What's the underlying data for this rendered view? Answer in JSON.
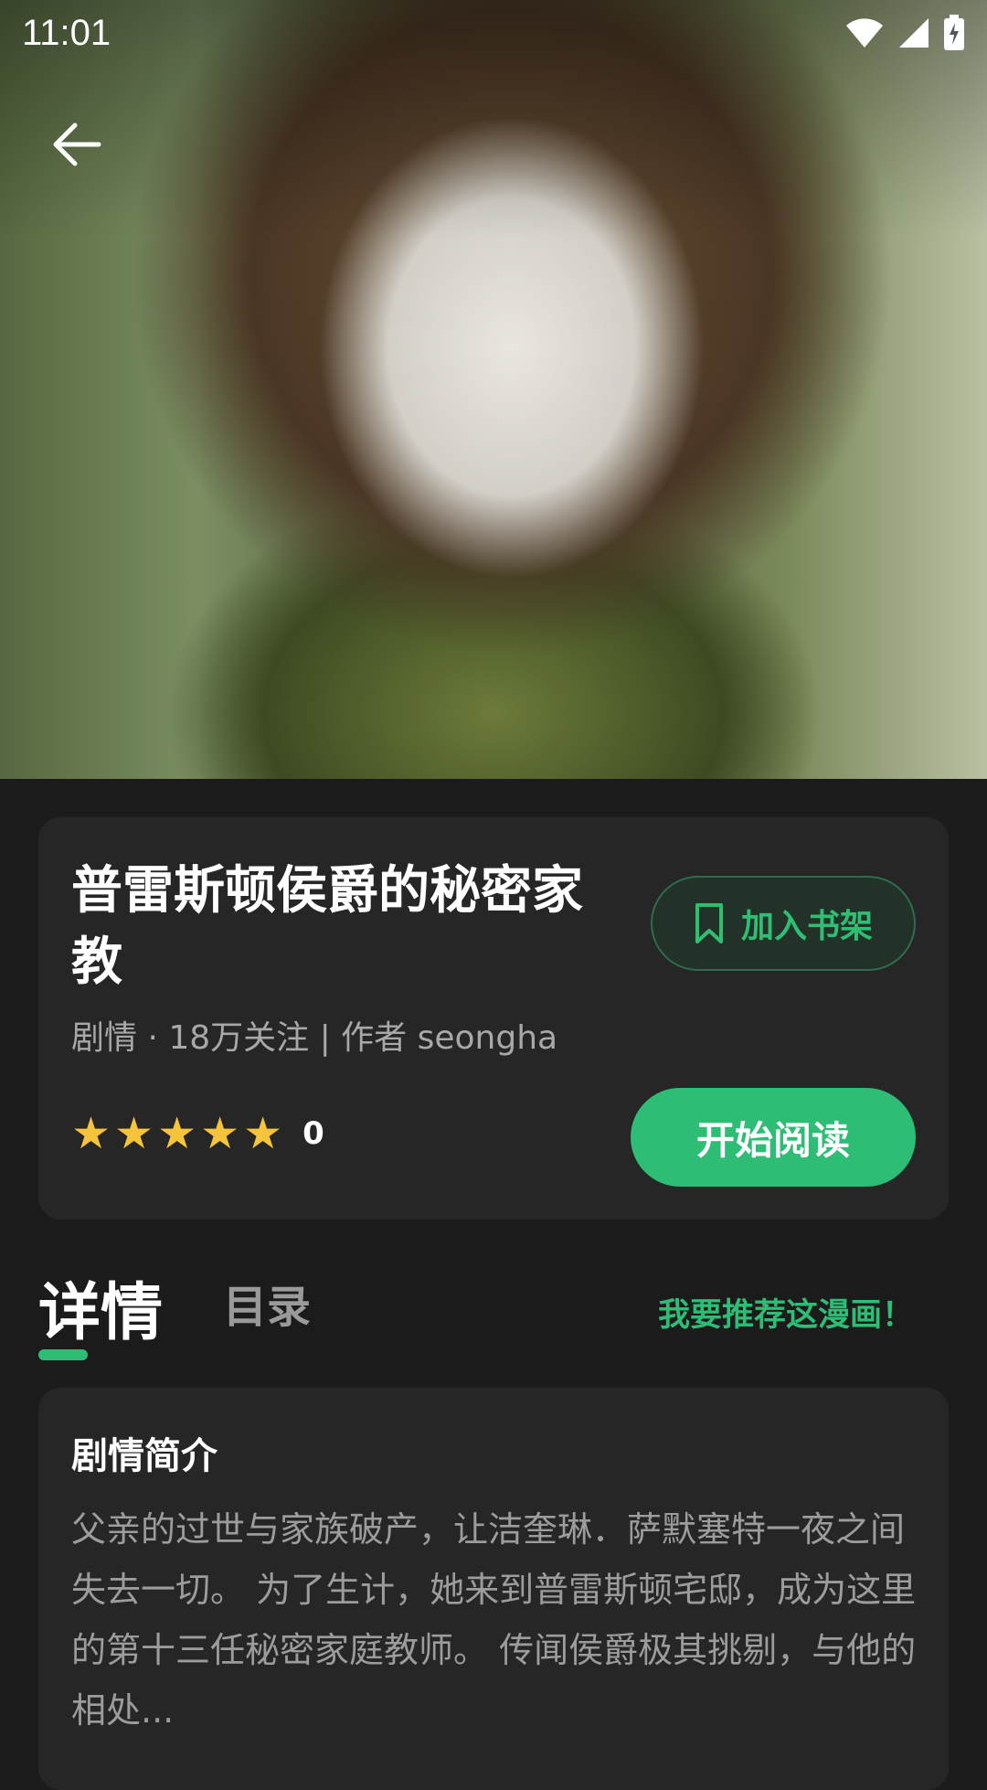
{
  "status_bar": {
    "time": "11:01"
  },
  "comic": {
    "title": "普雷斯顿侯爵的秘密家教",
    "meta": "剧情 · 18万关注 | 作者 seongha",
    "rating": {
      "stars": 5,
      "value": "0"
    }
  },
  "actions": {
    "bookshelf_label": "加入书架",
    "read_label": "开始阅读"
  },
  "tabs": {
    "detail": "详情",
    "toc": "目录",
    "recommend": "我要推荐这漫画！"
  },
  "synopsis": {
    "heading": "剧情简介",
    "text": "父亲的过世与家族破产，让洁奎琳．萨默塞特一夜之间失去一切。 为了生计，她来到普雷斯顿宅邸，成为这里的第十三任秘密家庭教师。 传闻侯爵极其挑剔，与他的相处..."
  },
  "colors": {
    "accent": "#2dbd75",
    "star": "#f6c43a",
    "card": "#262626",
    "background": "#1b1b1b"
  }
}
